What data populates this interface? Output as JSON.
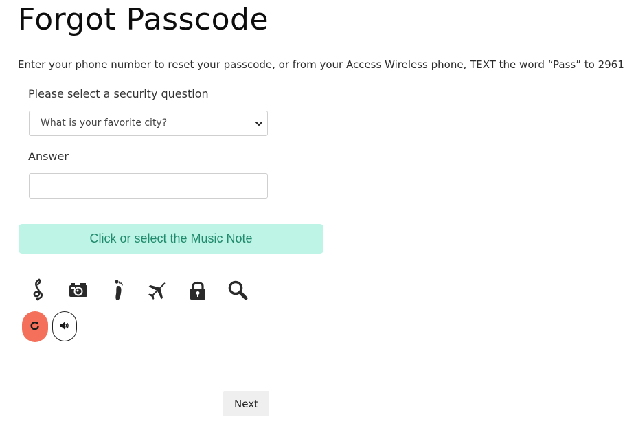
{
  "page": {
    "title": "Forgot Passcode",
    "instructions": "Enter your phone number to reset your passcode, or from your Access Wireless phone, TEXT the word “Pass” to 2961"
  },
  "form": {
    "question_label": "Please select a security question",
    "question_selected": "What is your favorite city?",
    "answer_label": "Answer",
    "answer_value": ""
  },
  "captcha": {
    "prompt": "Click or select the Music Note",
    "icons": [
      "music-note-icon",
      "camera-icon",
      "footprint-icon",
      "airplane-icon",
      "lock-icon",
      "search-icon"
    ],
    "refresh_icon": "refresh-icon",
    "audio_icon": "speaker-icon",
    "colors": {
      "banner_bg": "#bdf4e6",
      "banner_text": "#1f8a6c",
      "refresh_bg": "#f5705a"
    }
  },
  "actions": {
    "next_label": "Next"
  }
}
